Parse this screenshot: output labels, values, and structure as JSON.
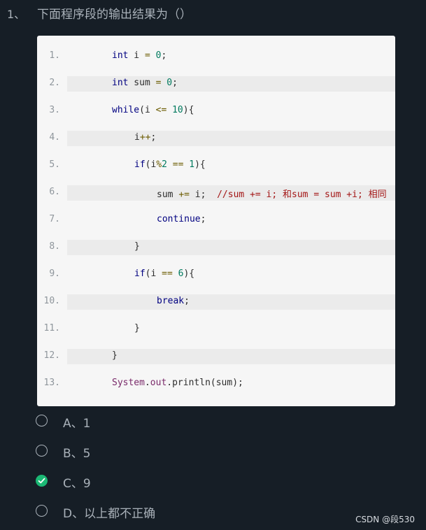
{
  "question": {
    "number": "1、",
    "text": "下面程序段的输出结果为（）"
  },
  "code": {
    "line_numbers": [
      "1.",
      "2.",
      "3.",
      "4.",
      "5.",
      "6.",
      "7.",
      "8.",
      "9.",
      "10.",
      "11.",
      "12.",
      "13."
    ],
    "lines": [
      "int i = 0;",
      "int sum = 0;",
      "while(i <= 10){",
      "i++;",
      "if(i%2 == 1){",
      "sum += i;  //sum += i; 和sum = sum +i; 相同",
      "continue;",
      "}",
      "if(i == 6){",
      "break;",
      "}",
      "}",
      "System.out.println(sum);"
    ]
  },
  "options": [
    {
      "label": "A、1",
      "selected": false
    },
    {
      "label": "B、5",
      "selected": false
    },
    {
      "label": "C、9",
      "selected": true
    },
    {
      "label": "D、以上都不正确",
      "selected": false
    }
  ],
  "colors": {
    "background": "#161e26",
    "selected": "#1bb874",
    "text": "#a9b1b9"
  },
  "watermark": "CSDN @段530"
}
